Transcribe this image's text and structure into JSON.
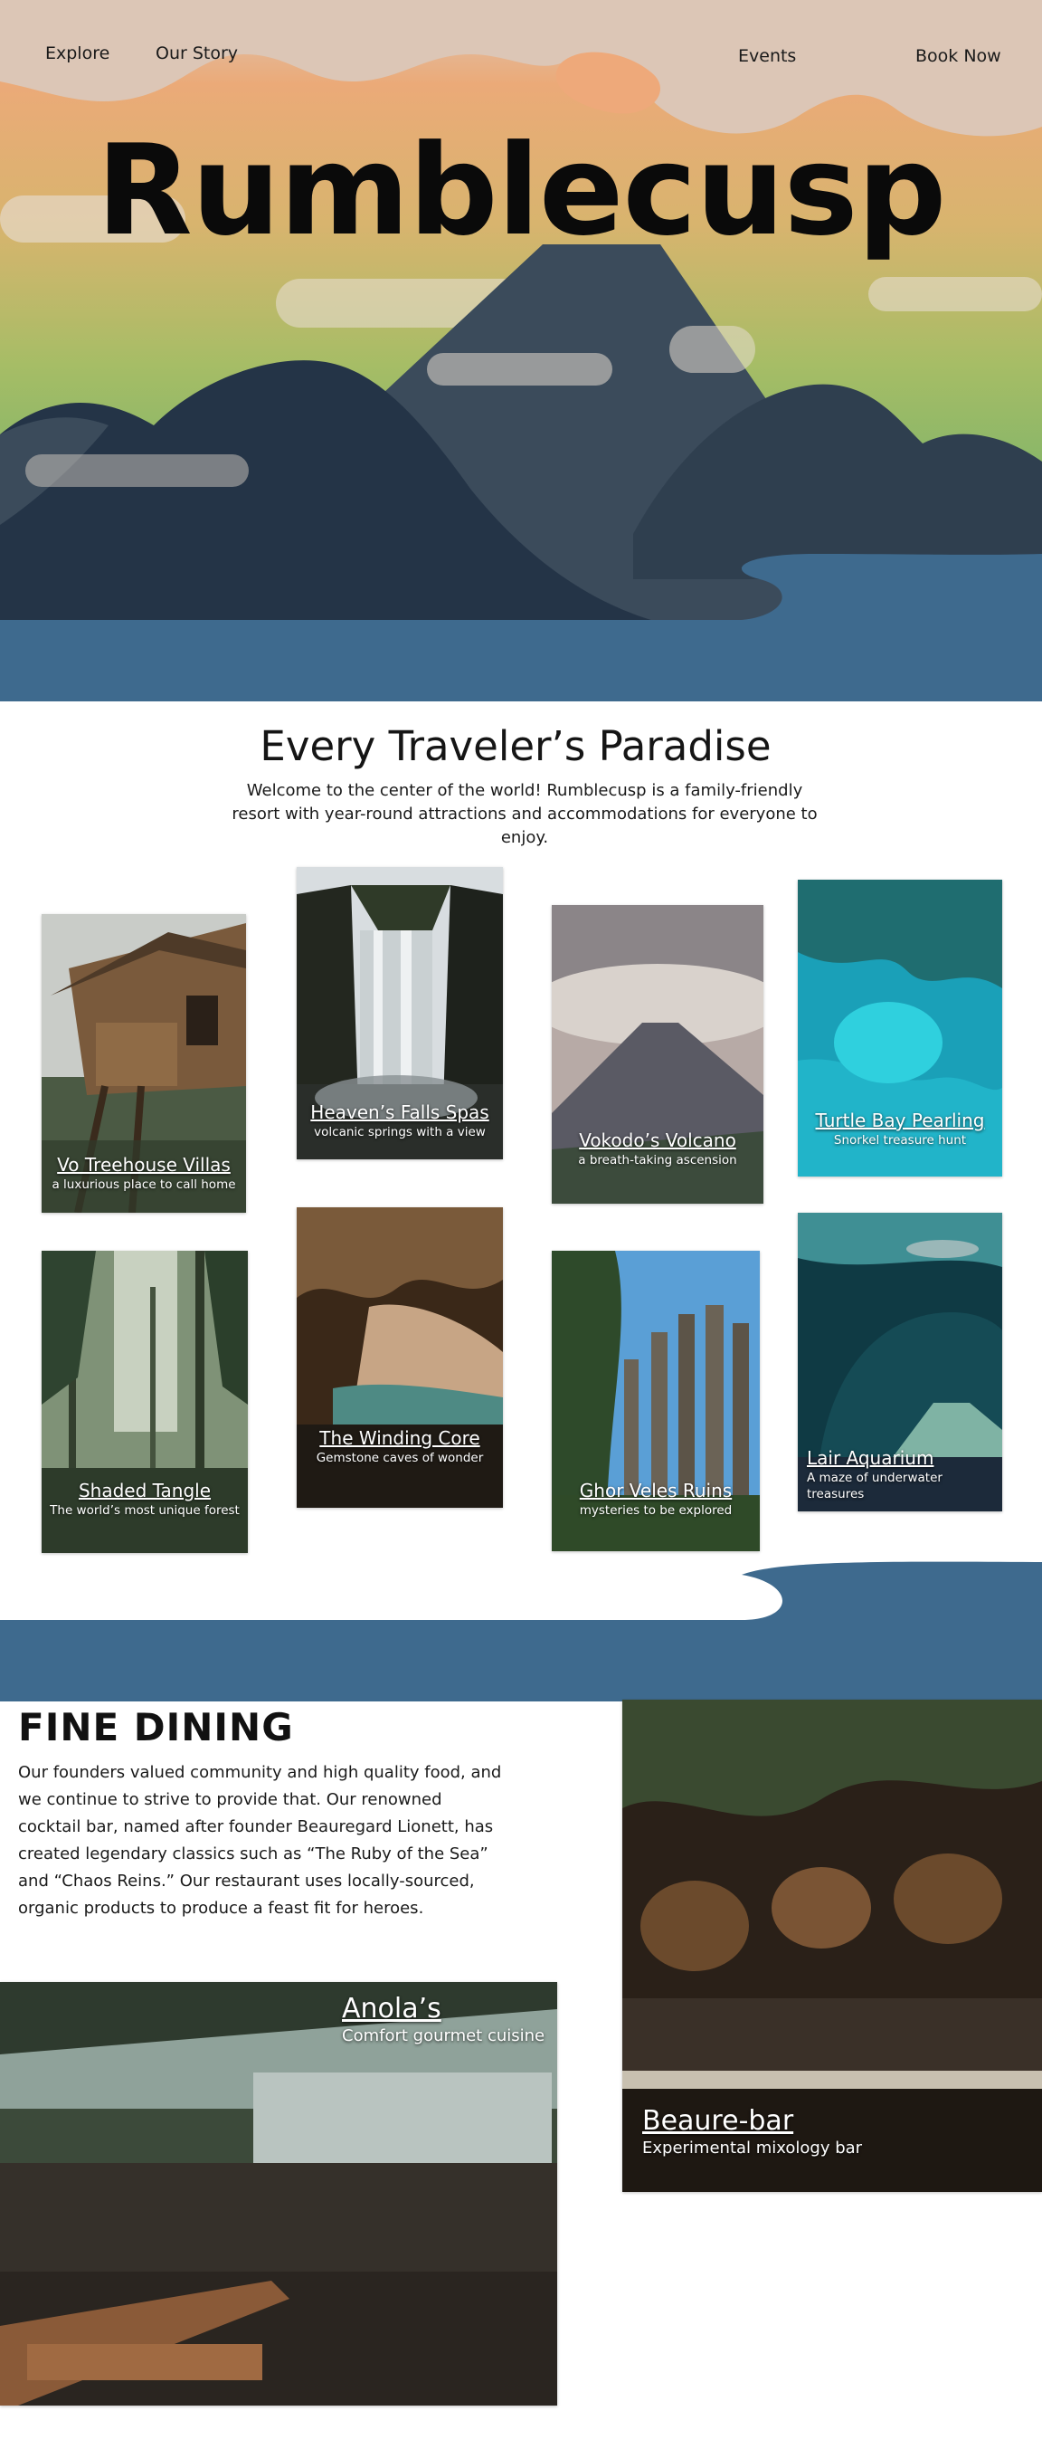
{
  "nav": {
    "explore": "Explore",
    "our_story": "Our Story",
    "events": "Events",
    "book_now": "Book Now"
  },
  "hero": {
    "brand": "Rumblecusp"
  },
  "intro": {
    "title": "Every Traveler’s Paradise",
    "text": "Welcome to the center of the world! Rumblecusp is a family-friendly resort with year-round attractions and accommodations for everyone to enjoy."
  },
  "attractions": [
    {
      "title": "Vo Treehouse Villas",
      "subtitle": "a luxurious place to call home"
    },
    {
      "title": "Heaven’s Falls Spas",
      "subtitle": "volcanic springs with a view"
    },
    {
      "title": "Vokodo’s Volcano",
      "subtitle": "a breath-taking ascension"
    },
    {
      "title": "Turtle Bay Pearling",
      "subtitle": "Snorkel treasure hunt"
    },
    {
      "title": "Shaded Tangle",
      "subtitle": "The world’s  most unique forest"
    },
    {
      "title": "The Winding Core",
      "subtitle": "Gemstone caves of wonder"
    },
    {
      "title": "Ghor Veles Ruins",
      "subtitle": "mysteries to be explored"
    },
    {
      "title": "Lair Aquarium",
      "subtitle": "A maze of underwater treasures"
    }
  ],
  "dining": {
    "title": "FINE DINING",
    "text": "Our founders valued community and high quality food, and we continue to strive to provide that. Our renowned cocktail bar, named after founder Beauregard Lionett, has created legendary classics such as “The Ruby of the Sea” and “Chaos Reins.” Our restaurant uses locally-sourced, organic products to produce a feast fit for heroes.",
    "venues": [
      {
        "title": "Anola’s",
        "subtitle": "Comfort gourmet cuisine"
      },
      {
        "title": "Beaure-bar",
        "subtitle": "Experimental mixology bar"
      }
    ]
  },
  "colors": {
    "sky_top": "#dcc6b6",
    "sky_orange": "#eaa676",
    "sky_green": "#9cbc66",
    "mountain_dark": "#243447",
    "mountain_mid": "#3b4b5b",
    "water": "#3e6a8e",
    "cloud": "#e6dccf"
  },
  "icons": {
    "hero": "volcano-landscape-illustration"
  }
}
